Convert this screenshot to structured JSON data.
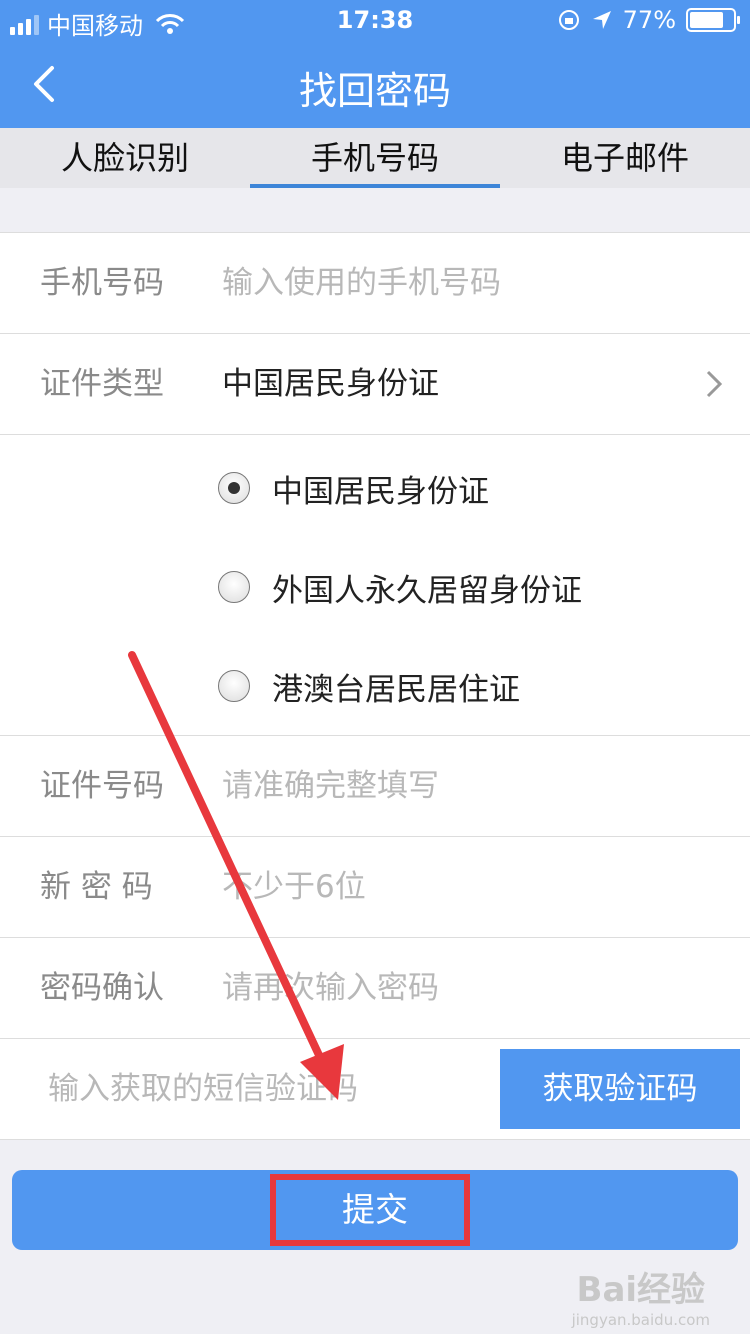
{
  "status_bar": {
    "carrier": "中国移动",
    "time": "17:38",
    "battery": "77%"
  },
  "nav": {
    "title": "找回密码"
  },
  "tabs": [
    {
      "label": "人脸识别",
      "active": false
    },
    {
      "label": "手机号码",
      "active": true
    },
    {
      "label": "电子邮件",
      "active": false
    }
  ],
  "form": {
    "phone": {
      "label": "手机号码",
      "placeholder": "输入使用的手机号码"
    },
    "id_type": {
      "label": "证件类型",
      "value": "中国居民身份证"
    },
    "id_options": [
      "中国居民身份证",
      "外国人永久居留身份证",
      "港澳台居民居住证"
    ],
    "id_number": {
      "label": "证件号码",
      "placeholder": "请准确完整填写"
    },
    "new_password": {
      "label": "新 密 码",
      "placeholder": "不少于6位"
    },
    "confirm_password": {
      "label": "密码确认",
      "placeholder": "请再次输入密码"
    },
    "sms_code": {
      "placeholder": "输入获取的短信验证码",
      "button": "获取验证码"
    }
  },
  "submit_label": "提交",
  "watermark": {
    "logo": "Bai经验",
    "sub": "jingyan.baidu.com"
  },
  "colors": {
    "primary": "#5197f0",
    "annotation": "#e8383d"
  }
}
